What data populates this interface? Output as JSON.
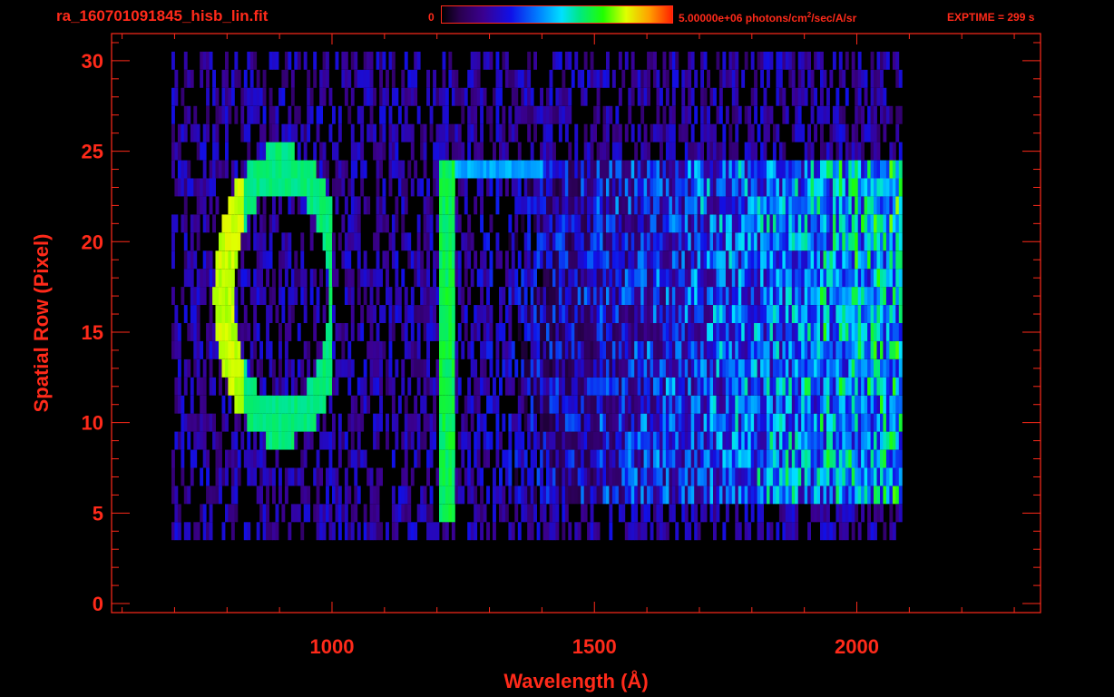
{
  "header": {
    "file_title": "ra_160701091845_hisb_lin.fit",
    "colorbar_min": "0",
    "colorbar_max": "5.00000e+06 photons/cm",
    "colorbar_max_sup": "2",
    "colorbar_max_rest": "/sec/A/sr",
    "exptime": "EXPTIME = 299 s"
  },
  "chart_data": {
    "type": "heatmap",
    "title": "ra_160701091845_hisb_lin.fit",
    "xlabel": "Wavelength (Å)",
    "ylabel": "Spatial Row (Pixel)",
    "xlim": [
      580,
      2350
    ],
    "ylim": [
      -0.5,
      31.5
    ],
    "x_ticks": [
      1000,
      1500,
      2000
    ],
    "y_ticks": [
      0,
      5,
      10,
      15,
      20,
      25,
      30
    ],
    "colorbar": {
      "min": 0,
      "max": 5000000,
      "units": "photons/cm^2/sec/A/sr",
      "colormap": "rainbow"
    },
    "detector_coverage": {
      "wavelength_range": [
        690,
        2080
      ],
      "row_range": [
        4,
        30
      ]
    },
    "features": [
      {
        "name": "vertical emission line",
        "wavelength": 1216,
        "rows": [
          5,
          24
        ]
      },
      {
        "name": "bright upper streak",
        "wavelength_range": [
          1210,
          1400
        ],
        "rows": [
          24,
          25
        ]
      },
      {
        "name": "curved arc",
        "wavelength_range": [
          780,
          1070
        ],
        "rows": [
          10,
          24
        ]
      },
      {
        "name": "long-wavelength continuum",
        "wavelength_range": [
          1800,
          2070
        ],
        "rows": [
          4,
          30
        ]
      }
    ],
    "grid": false,
    "colors": {
      "axis": "#ff2a1a",
      "background": "#000000"
    }
  }
}
